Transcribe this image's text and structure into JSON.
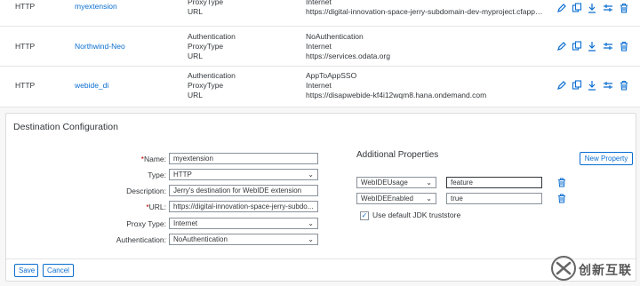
{
  "destinations": [
    {
      "type": "HTTP",
      "name": "myextension",
      "props": [
        "ProxyType",
        "URL"
      ],
      "vals": [
        "Internet",
        "https://digital-innovation-space-jerry-subdomain-dev-myproject.cfapps.eu..."
      ]
    },
    {
      "type": "HTTP",
      "name": "Northwind-Neo",
      "props": [
        "Authentication",
        "ProxyType",
        "URL"
      ],
      "vals": [
        "NoAuthentication",
        "Internet",
        "https://services.odata.org"
      ]
    },
    {
      "type": "HTTP",
      "name": "webide_di",
      "props": [
        "Authentication",
        "ProxyType",
        "URL"
      ],
      "vals": [
        "AppToAppSSO",
        "Internet",
        "https://disapwebide-kf4i12wqm8.hana.ondemand.com"
      ]
    }
  ],
  "config": {
    "title": "Destination Configuration",
    "req_mark": "*",
    "labels": {
      "name": "Name:",
      "type": "Type:",
      "description": "Description:",
      "url": "URL:",
      "proxy_type": "Proxy Type:",
      "authentication": "Authentication:"
    },
    "values": {
      "name": "myextension",
      "type": "HTTP",
      "description": "Jerry's destination for WebIDE extension",
      "url": "https://digital-innovation-space-jerry-subdo...",
      "proxy_type": "Internet",
      "authentication": "NoAuthentication"
    },
    "additional": {
      "title": "Additional Properties",
      "new_button": "New Property",
      "rows": [
        {
          "key": "WebIDEUsage",
          "value": "feature"
        },
        {
          "key": "WebIDEEnabled",
          "value": "true"
        }
      ],
      "checkbox_label": "Use default JDK truststore",
      "checkbox_mark": "✓"
    },
    "save": "Save",
    "cancel": "Cancel"
  },
  "watermark": {
    "text": "创新互联"
  },
  "colors": {
    "accent": "#0a6ed1",
    "required": "#bb0000"
  }
}
